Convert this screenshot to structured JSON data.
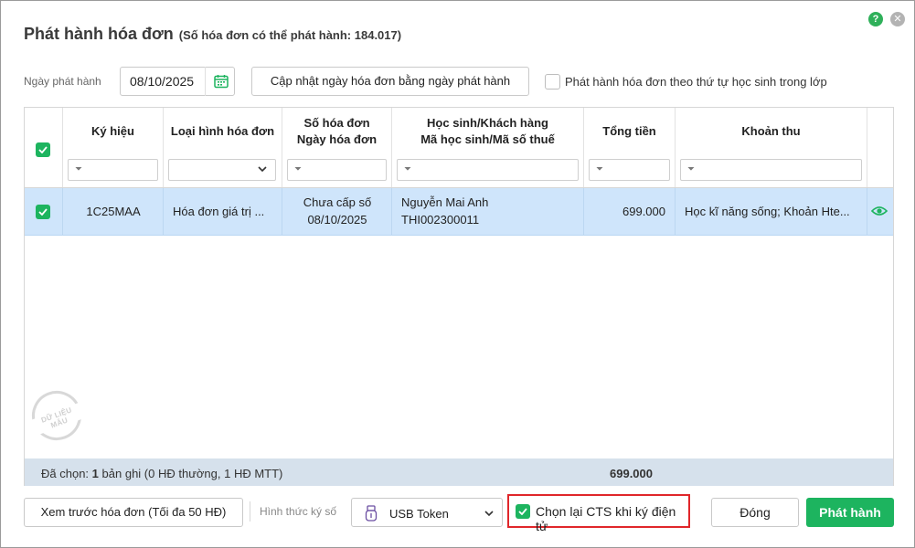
{
  "dialog": {
    "title": "Phát hành hóa đơn",
    "subtitle": "(Số hóa đơn có thể phát hành: 184.017)",
    "help_icon": "question-circle-icon",
    "close_icon": "close-circle-icon",
    "help_glyph": "?",
    "close_glyph": "✕"
  },
  "filters": {
    "date_label": "Ngày phát hành",
    "date_value": "08/10/2025",
    "update_button": "Cập nhật ngày hóa đơn bằng ngày phát hành",
    "order_checkbox_label": "Phát hành hóa đơn theo thứ tự học sinh trong lớp",
    "order_checked": false
  },
  "grid": {
    "columns": [
      {
        "key": "symbol",
        "label_1": "Ký hiệu",
        "label_2": ""
      },
      {
        "key": "type",
        "label_1": "Loại hình hóa đơn",
        "label_2": ""
      },
      {
        "key": "number",
        "label_1": "Số hóa đơn",
        "label_2": "Ngày hóa đơn"
      },
      {
        "key": "student",
        "label_1": "Học sinh/Khách hàng",
        "label_2": "Mã học sinh/Mã số thuế"
      },
      {
        "key": "total",
        "label_1": "Tổng tiền",
        "label_2": ""
      },
      {
        "key": "fees",
        "label_1": "Khoản thu",
        "label_2": ""
      }
    ],
    "filter_glyph": "⏷",
    "rows": [
      {
        "checked": true,
        "symbol": "1C25MAA",
        "type": "Hóa đơn giá trị ...",
        "number": "Chưa cấp số",
        "date": "08/10/2025",
        "student_name": "Nguyễn Mai Anh",
        "student_code": "THI002300011",
        "total": "699.000",
        "fees": "Học kĩ năng sống; Khoản Hte...",
        "action_icon": "eye-icon"
      }
    ],
    "watermark": "DỮ LIỆU MẪU",
    "summary": {
      "label": "Đã chọn:",
      "count": "1",
      "detail": "bản ghi (0 HĐ thường, 1 HĐ MTT)",
      "total": "699.000"
    }
  },
  "footer": {
    "preview_button": "Xem trước hóa đơn (Tối đa 50 HĐ)",
    "sign_method_label": "Hình thức ký số",
    "sign_method_value": "USB Token",
    "cts_checkbox_label": "Chọn lại CTS khi ký điện tử",
    "cts_checked": true,
    "close_button": "Đóng",
    "issue_button": "Phát hành"
  },
  "colors": {
    "accent": "#1db45f",
    "selected_row": "#cfe5fb",
    "summary_bg": "#d6e1ec",
    "highlight_border": "#e0262a"
  }
}
